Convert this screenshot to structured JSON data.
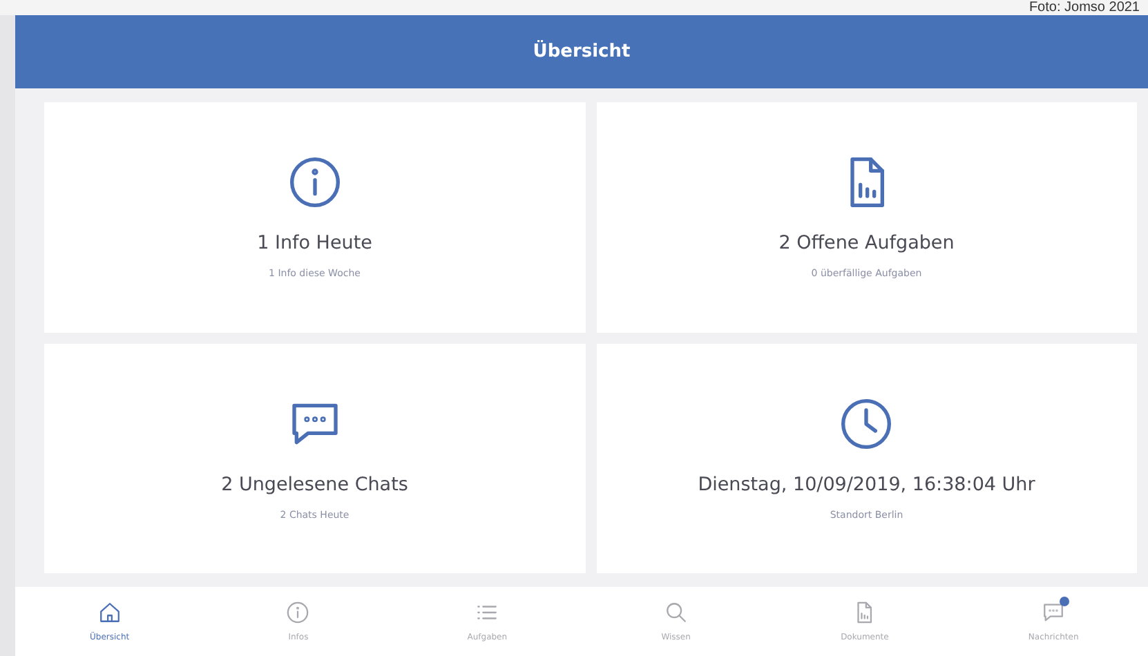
{
  "caption": "Foto: Jomso 2021",
  "header": {
    "title": "Übersicht"
  },
  "tiles": [
    {
      "kind": "info",
      "title": "1 Info Heute",
      "subtitle": "1 Info diese Woche"
    },
    {
      "kind": "document",
      "title": "2 Offene Aufgaben",
      "subtitle": "0 überfällige Aufgaben"
    },
    {
      "kind": "chat",
      "title": "2 Ungelesene Chats",
      "subtitle": "2 Chats Heute"
    },
    {
      "kind": "clock",
      "title": "Dienstag, 10/09/2019, 16:38:04 Uhr",
      "subtitle": "Standort Berlin"
    }
  ],
  "nav": [
    {
      "kind": "home",
      "label": "Übersicht",
      "selected": true,
      "badge": false
    },
    {
      "kind": "info",
      "label": "Infos",
      "selected": false,
      "badge": false
    },
    {
      "kind": "list",
      "label": "Aufgaben",
      "selected": false,
      "badge": false
    },
    {
      "kind": "search",
      "label": "Wissen",
      "selected": false,
      "badge": false
    },
    {
      "kind": "document",
      "label": "Dokumente",
      "selected": false,
      "badge": false
    },
    {
      "kind": "chat",
      "label": "Nachrichten",
      "selected": false,
      "badge": true
    }
  ]
}
